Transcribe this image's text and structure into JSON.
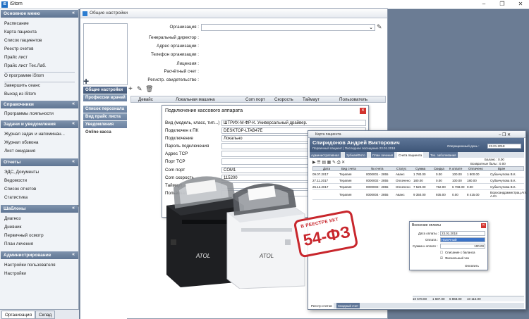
{
  "app": {
    "title": "iStom",
    "logo": "iS"
  },
  "sidebar": {
    "sections": [
      {
        "title": "Основное меню",
        "items": [
          "Расписание",
          "Карта пациента",
          "Список пациентов",
          "Реестр счетов",
          "Прайс лист",
          "Прайс лист Тех.Лаб.",
          "О программе  iStom",
          "Завершить сеанс",
          "Выход из iStom"
        ]
      },
      {
        "title": "Справочники",
        "items": [
          "Программы лояльности"
        ]
      },
      {
        "title": "Задачи и уведомления",
        "items": [
          "Журнал задач и напоминан...",
          "Журнал обзвона",
          "Лист ожидания"
        ]
      },
      {
        "title": "Отчеты",
        "items": [
          "ЭДС, Документы",
          "Ведомости",
          "Список отчетов",
          "Статистика"
        ]
      },
      {
        "title": "Шаблоны",
        "items": [
          "Диагноз",
          "Дневник",
          "Первичный осмотр",
          "План лечения"
        ]
      },
      {
        "title": "Администрирование",
        "items": [
          "Настройки пользователя",
          "Настройки"
        ]
      }
    ],
    "bottom_tabs": [
      "Организация",
      "Склад"
    ]
  },
  "settings": {
    "title": "Общие настройки",
    "org_label": "Организация :",
    "fields": [
      "Генеральный директор :",
      "Адрес организации :",
      "Телефон организации :",
      "Лицензия :",
      "Расчётный счет :",
      "Регистр. свидетельство :"
    ],
    "menu": [
      "Общие настройки",
      "Профессии врачей",
      "Список персонала",
      "Вид прайс листа",
      "Уведомления",
      "Online касса"
    ],
    "grid_headers": [
      "Девайс",
      "Локальная машина",
      "Com порт",
      "Скорость",
      "Таймаут",
      "Пользователь"
    ]
  },
  "kassa": {
    "title": "Подключение кассового аппарата",
    "rows": [
      {
        "label": "Вид (модель, класс, тип...)",
        "value": "ШТРИХ-М-ФР-К. Универсальный драйвер."
      },
      {
        "label": "Подключен к ПК",
        "value": "DESKTOP-LTAB47E"
      },
      {
        "label": "Подключение",
        "value": "Локально"
      },
      {
        "label": "Пароль подключения",
        "value": ""
      },
      {
        "label": "Адрес TCP",
        "value": ""
      },
      {
        "label": "Порт TCP",
        "value": ""
      },
      {
        "label": "Com порт",
        "value": "COM1"
      },
      {
        "label": "Com скорость",
        "value": "115200"
      },
      {
        "label": "Таймаут",
        "value": ""
      },
      {
        "label": "Пользователь",
        "value": ""
      }
    ]
  },
  "card": {
    "title": "Карта пациента",
    "patient_name": "Спиридонов Андрей Викторович",
    "patient_sub": "Первичный пациент | Последнее посещение 23.01.2018",
    "op_day_label": "Операционный день :",
    "op_day": "23.01.2018",
    "tabs": [
      "Административная",
      "Зубная/Фото",
      "План лечения",
      "Счета пациента",
      "Тех. заболевания"
    ],
    "balance": "Баланс : 0.00",
    "returned": "Возвратные балы : 0.00",
    "headers": [
      "Дата",
      "Вид счета",
      "№ счета",
      "Статус",
      "Сумма",
      "Скидка",
      "К оплате",
      "Оплачено",
      "Врач"
    ],
    "rows": [
      [
        "09.07.2017",
        "Терапия",
        "0000001 - 2855",
        "Аванс",
        "1 780.00",
        "0.00",
        "100.00",
        "1 800.00",
        "Субанчупова В.К."
      ],
      [
        "27.11.2017",
        "Терапия",
        "0000002 - 2855",
        "Оплачено",
        "180.00",
        "0.00",
        "100.00",
        "180.00",
        "Субанчупова В.К."
      ],
      [
        "25.12.2017",
        "Терапия",
        "0000003 - 2855",
        "Оплачено",
        "7 520.00",
        "752.00",
        "6 768.00",
        "0.00",
        "Субанчупова В.К."
      ],
      [
        "",
        "Терапия",
        "0000004 - 2855",
        "Аванс",
        "9 350.00",
        "935.00",
        "0.00",
        "8 415.00",
        "Воросандрамистрац.Агл. А.Ю."
      ]
    ],
    "totals": [
      "10 678.00",
      "1 687.00",
      "6 868.00",
      "10 115.00"
    ],
    "bottom_tabs": [
      "Реестр счетов",
      "Сводный счет"
    ]
  },
  "payment": {
    "title": "Внесение оплаты",
    "date_label": "Дата оплаты :",
    "date": "23.01.2018",
    "method_label": "Оплата :",
    "method": "Наличный",
    "sum_label": "Сумма к оплате :",
    "sum": "100.00",
    "check1": "Списание с баланса",
    "check2": "Фискальный чек",
    "pay_button": "Оплатить"
  },
  "printers": {
    "brand": "ATOL"
  },
  "badge": {
    "line1": "В РЕЕСТРЕ ККТ",
    "line2": "54-ФЗ"
  },
  "colors": {
    "sidebar_header": "#6a80a0",
    "badge_red": "#c8262c",
    "accent_blue": "#1f6fc4"
  }
}
